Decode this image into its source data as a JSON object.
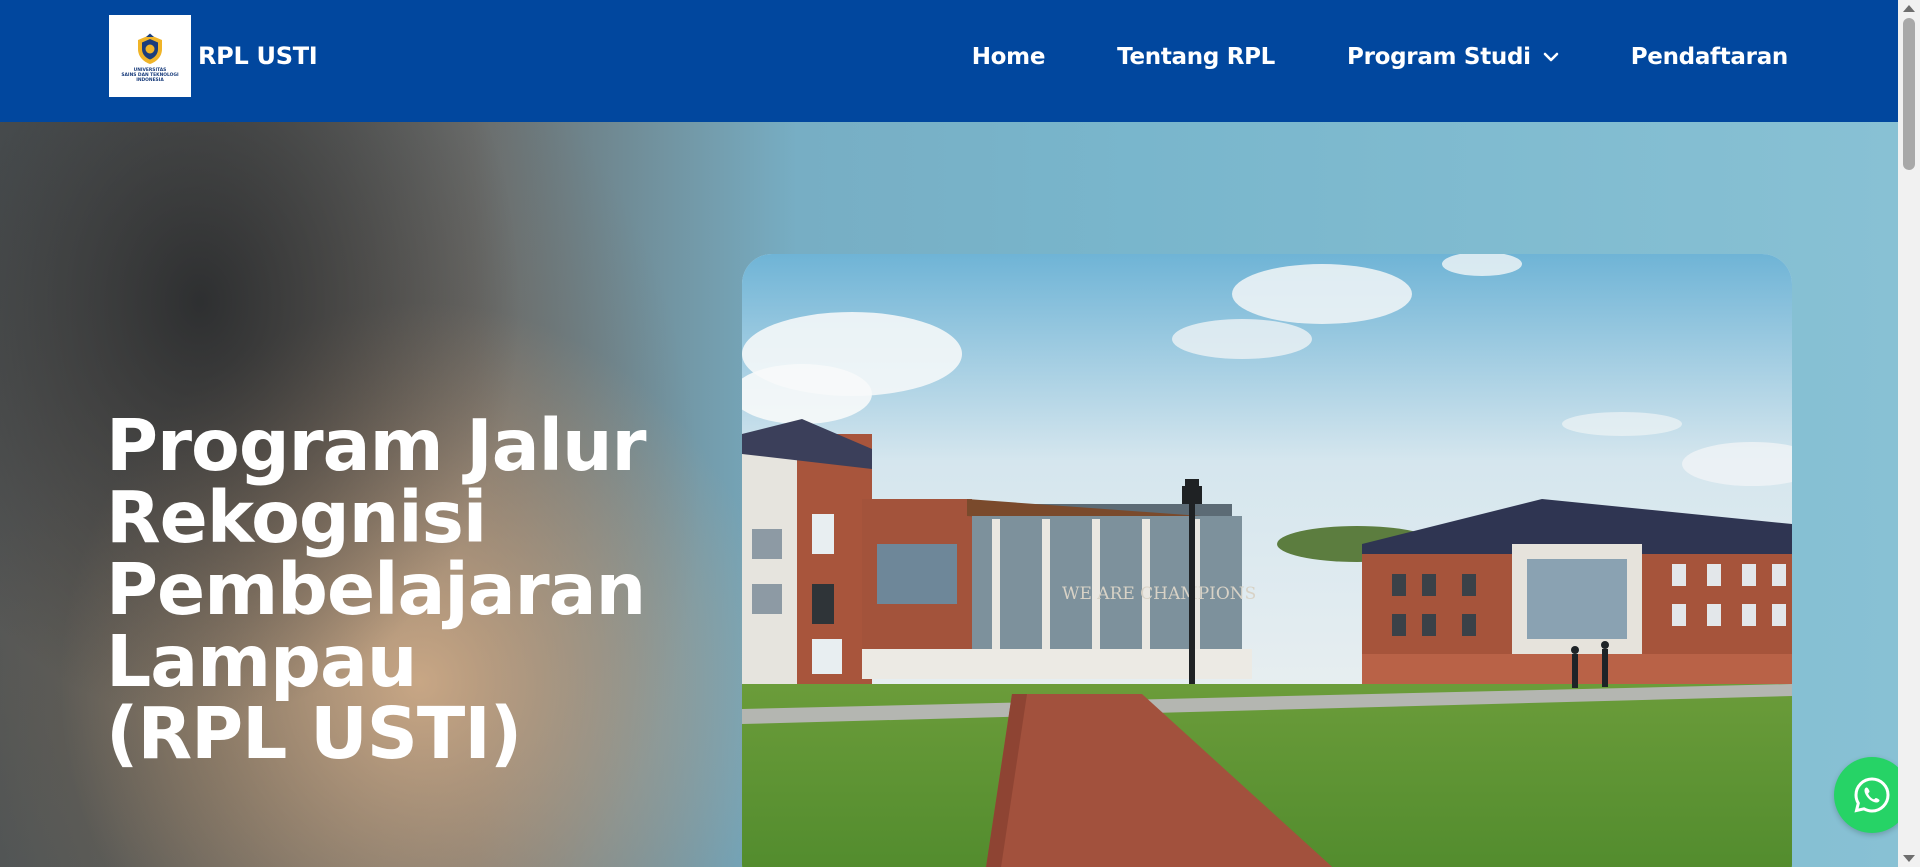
{
  "header": {
    "brand_name": "RPL USTI",
    "logo": {
      "icon": "university-crest-icon",
      "lines": [
        "UNIVERSITAS",
        "SAINS DAN TEKNOLOGI",
        "INDONESIA"
      ]
    },
    "nav": [
      {
        "label": "Home"
      },
      {
        "label": "Tentang RPL"
      },
      {
        "label": "Program Studi",
        "icon": "chevron-down-icon"
      },
      {
        "label": "Pendaftaran"
      }
    ]
  },
  "hero": {
    "title_lines": [
      "Program Jalur",
      "Rekognisi",
      "Pembelajaran",
      "Lampau",
      "(RPL USTI)"
    ],
    "image": {
      "subject": "campus-building-photo",
      "sign_text": "WE ARE CHAMPIONS"
    }
  },
  "floating": {
    "whatsapp_icon": "whatsapp-icon"
  },
  "colors": {
    "navbar": "#01479e",
    "whatsapp": "#26d366",
    "text_light": "#ffffff"
  }
}
